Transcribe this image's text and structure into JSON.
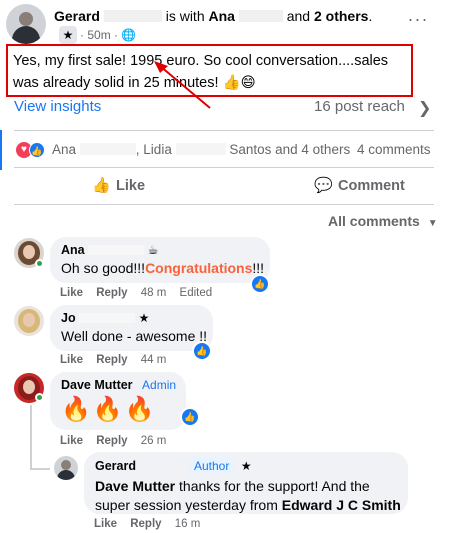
{
  "post": {
    "author": "Gerard",
    "with_text": "is with",
    "tagged": "Ana",
    "and_text": "and",
    "others": "2 others",
    "time": "50m",
    "audience_icon": "globe-icon",
    "more_icon": "more-dots-icon",
    "text": "Yes, my first sale! 1995 euro. So cool conversation....sales was already solid in 25 minutes! 👍😄"
  },
  "insights": {
    "label": "View insights",
    "reach": "16 post reach"
  },
  "reactions": {
    "name1": "Ana",
    "name2": ", Lidia",
    "name3": "Santos and 4 others",
    "comments_count": "4 comments"
  },
  "actions": {
    "like": "Like",
    "comment": "Comment"
  },
  "filter": {
    "label": "All comments"
  },
  "comments": [
    {
      "name": "Ana",
      "badge_icon": "coffee-icon",
      "text_before": "Oh so good!!!",
      "text_highlight": "Congratulations",
      "text_after": "!!!",
      "like": "Like",
      "reply": "Reply",
      "time": "48 m",
      "edited": "Edited"
    },
    {
      "name": "Jo",
      "badge_icon": "star-icon",
      "text": "Well done - awesome !!",
      "like": "Like",
      "reply": "Reply",
      "time": "44 m"
    },
    {
      "name": "Dave Mutter",
      "role": "Admin",
      "text": "🔥🔥🔥",
      "like": "Like",
      "reply": "Reply",
      "time": "26 m"
    },
    {
      "name": "Gerard",
      "role": "Author",
      "badge_icon": "star-icon",
      "mention1": "Dave Mutter",
      "text_mid": " thanks for the support! And the",
      "text_line2": "super session yesterday from ",
      "mention2": "Edward J C Smith",
      "like": "Like",
      "reply": "Reply",
      "time": "16 m"
    }
  ],
  "colors": {
    "accent": "#1877f2",
    "highlight_box": "#e00000",
    "congrats": "#f7633a"
  }
}
